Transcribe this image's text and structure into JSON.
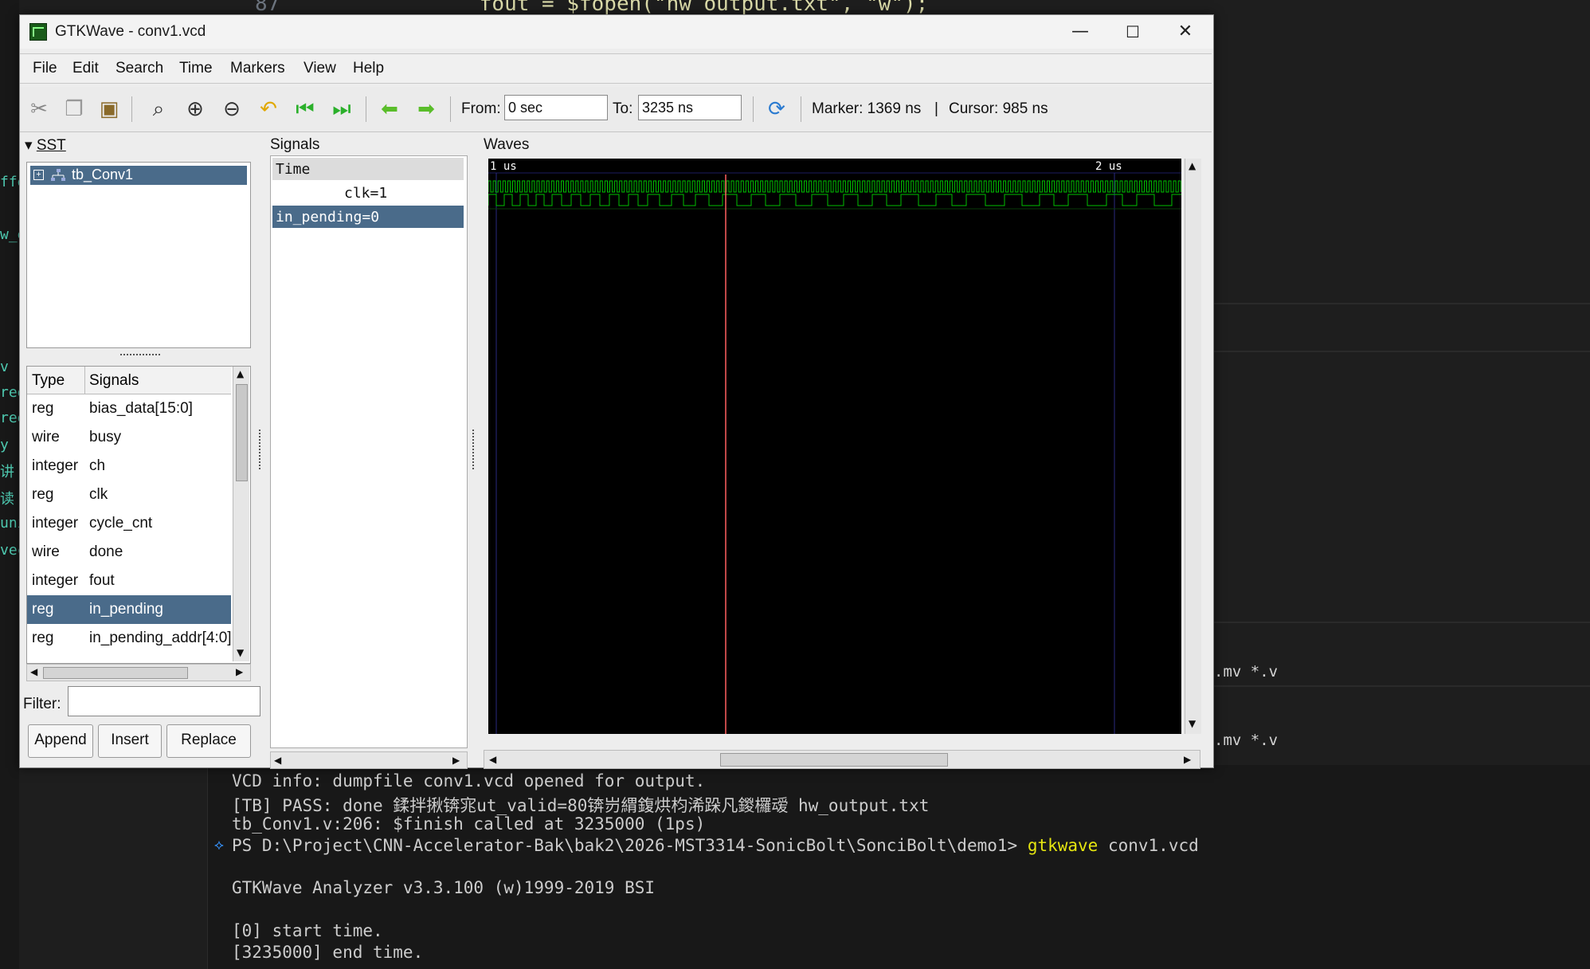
{
  "editor": {
    "line_number": "87",
    "code": "fout = $fopen(\"hw_output.txt\", \"w\");"
  },
  "gutter_fragments": [
    "ffe",
    "w_e",
    "v",
    "ree",
    "ree",
    "y",
    "讲",
    "读",
    "uni",
    "vec"
  ],
  "window": {
    "title": "GTKWave - conv1.vcd",
    "controls": [
      "—",
      "☐",
      "✕"
    ]
  },
  "menu": [
    "File",
    "Edit",
    "Search",
    "Time",
    "Markers",
    "View",
    "Help"
  ],
  "toolbar": {
    "icons": [
      "cut-icon",
      "copy-icon",
      "paste-icon",
      "zoom-fit-icon",
      "zoom-in-icon",
      "zoom-out-icon",
      "undo-zoom-icon",
      "go-start-icon",
      "go-end-icon",
      "prev-edge-icon",
      "next-edge-icon",
      "reload-icon"
    ],
    "from_label": "From:",
    "from_value": "0 sec",
    "to_label": "To:",
    "to_value": "3235 ns",
    "marker": "Marker: 1369 ns",
    "separator": "|",
    "cursor": "Cursor: 985 ns"
  },
  "sst": {
    "header": "SST",
    "tree_root": "tb_Conv1"
  },
  "signal_list": {
    "col_type": "Type",
    "col_signals": "Signals",
    "rows": [
      {
        "type": "reg",
        "name": "bias_data[15:0]",
        "selected": false
      },
      {
        "type": "wire",
        "name": "busy",
        "selected": false
      },
      {
        "type": "integer",
        "name": "ch",
        "selected": false
      },
      {
        "type": "reg",
        "name": "clk",
        "selected": false
      },
      {
        "type": "integer",
        "name": "cycle_cnt",
        "selected": false
      },
      {
        "type": "wire",
        "name": "done",
        "selected": false
      },
      {
        "type": "integer",
        "name": "fout",
        "selected": false
      },
      {
        "type": "reg",
        "name": "in_pending",
        "selected": true
      },
      {
        "type": "reg",
        "name": "in_pending_addr[4:0]",
        "selected": false
      }
    ]
  },
  "filter": {
    "label": "Filter:",
    "value": ""
  },
  "buttons": {
    "append": "Append",
    "insert": "Insert",
    "replace": "Replace"
  },
  "signals_pane": {
    "header": "Signals",
    "time_label": "Time",
    "rows": [
      {
        "label": "clk=1",
        "selected": false
      },
      {
        "label": "in_pending=0",
        "selected": true
      }
    ]
  },
  "waves_pane": {
    "header": "Waves",
    "ticks": [
      "1 us",
      "2 us"
    ],
    "wave_color": "#00c000",
    "marker_color": "#ff6060"
  },
  "terminal": {
    "lines": [
      "VCD info: dumpfile conv1.vcd opened for output.",
      "[TB] PASS: done 鍒拌揪锛宨ut_valid=80锛岃緭鍑烘枃浠跺凡鍐欏叆 hw_output.txt",
      "tb_Conv1.v:206: $finish called at 3235000 (1ps)"
    ],
    "prompt": "PS D:\\Project\\CNN-Accelerator-Bak\\bak2\\2026-MST3314-SonicBolt\\SonciBolt\\demo1> ",
    "command": "gtkwave",
    "command_args": " conv1.vcd",
    "output": [
      "GTKWave Analyzer v3.3.100 (w)1999-2019 BSI",
      "[0] start time.",
      "[3235000] end time."
    ],
    "side_text": ".mv *.v"
  }
}
